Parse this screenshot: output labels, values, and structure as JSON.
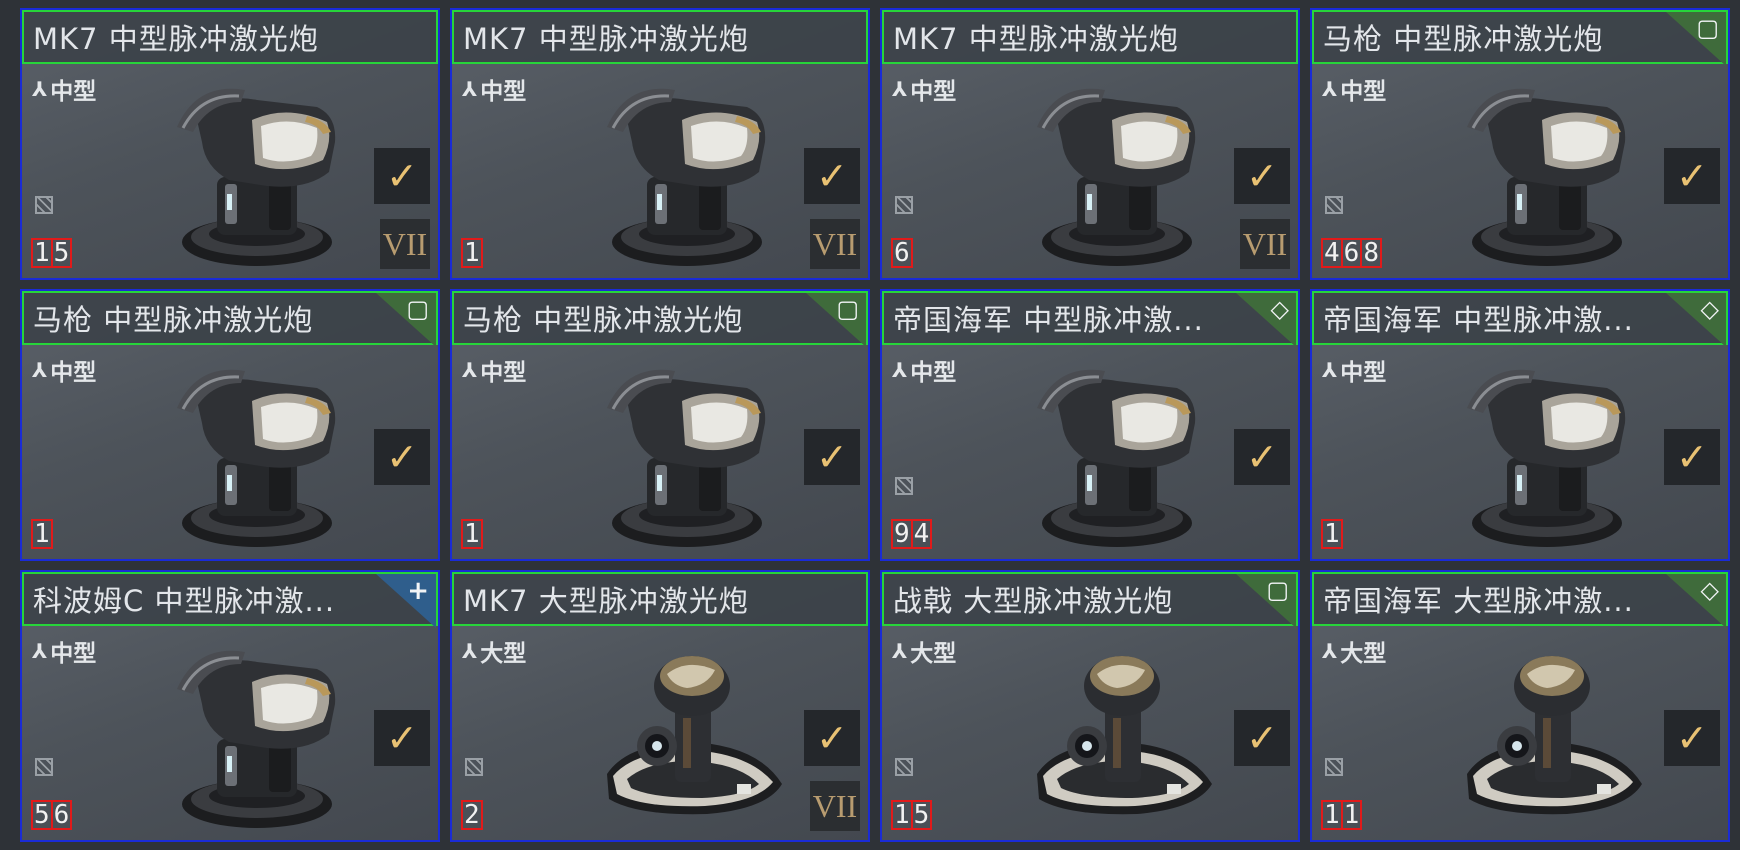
{
  "items": [
    {
      "name": "MK7 中型脉冲激光炮",
      "size": "中型",
      "turret": "medium",
      "quantity": "15",
      "corner": "",
      "unfit_icon": true,
      "tier": "VII"
    },
    {
      "name": "MK7 中型脉冲激光炮",
      "size": "中型",
      "turret": "medium",
      "quantity": "1",
      "corner": "",
      "unfit_icon": false,
      "tier": "VII"
    },
    {
      "name": "MK7 中型脉冲激光炮",
      "size": "中型",
      "turret": "medium",
      "quantity": "6",
      "corner": "",
      "unfit_icon": true,
      "tier": "VII"
    },
    {
      "name": "马枪 中型脉冲激光炮",
      "size": "中型",
      "turret": "medium",
      "quantity": "468",
      "corner": "square",
      "unfit_icon": true,
      "tier": ""
    },
    {
      "name": "马枪 中型脉冲激光炮",
      "size": "中型",
      "turret": "medium",
      "quantity": "1",
      "corner": "square",
      "unfit_icon": false,
      "tier": ""
    },
    {
      "name": "马枪 中型脉冲激光炮",
      "size": "中型",
      "turret": "medium",
      "quantity": "1",
      "corner": "square",
      "unfit_icon": false,
      "tier": ""
    },
    {
      "name": "帝国海军 中型脉冲激...",
      "size": "中型",
      "turret": "medium",
      "quantity": "94",
      "corner": "diamond",
      "unfit_icon": true,
      "tier": ""
    },
    {
      "name": "帝国海军 中型脉冲激...",
      "size": "中型",
      "turret": "medium",
      "quantity": "1",
      "corner": "diamond",
      "unfit_icon": false,
      "tier": ""
    },
    {
      "name": "科波姆C 中型脉冲激...",
      "size": "中型",
      "turret": "medium",
      "quantity": "56",
      "corner": "plus",
      "unfit_icon": true,
      "tier": ""
    },
    {
      "name": "MK7 大型脉冲激光炮",
      "size": "大型",
      "turret": "large",
      "quantity": "2",
      "corner": "",
      "unfit_icon": true,
      "tier": "VII"
    },
    {
      "name": "战戟 大型脉冲激光炮",
      "size": "大型",
      "turret": "large",
      "quantity": "15",
      "corner": "square",
      "unfit_icon": true,
      "tier": ""
    },
    {
      "name": "帝国海军 大型脉冲激...",
      "size": "大型",
      "turret": "large",
      "quantity": "11",
      "corner": "diamond",
      "unfit_icon": true,
      "tier": ""
    }
  ],
  "colors": {
    "card_border": "#1a2bd6",
    "title_border": "#27d43a",
    "quantity_border": "#e11a1a",
    "check_color": "#e8c173",
    "tier_color": "#b89c70",
    "corner_green": "#3f6b3b",
    "corner_blue": "#2f5e8c"
  },
  "icons": {
    "fitting": "fitting-size-icon",
    "check": "checkmark-icon",
    "unfit": "unfit-slash-icon",
    "square": "square-meta-icon",
    "diamond": "diamond-meta-icon",
    "plus": "plus-meta-icon"
  }
}
